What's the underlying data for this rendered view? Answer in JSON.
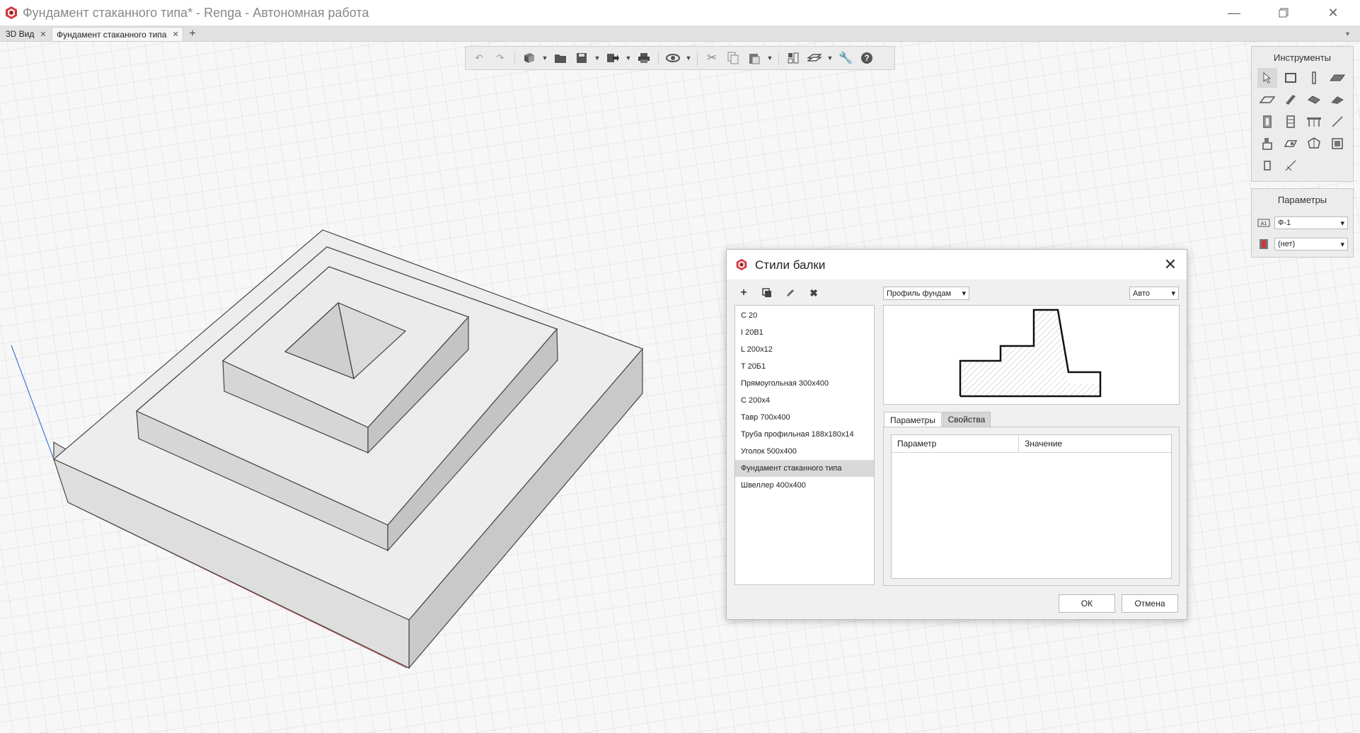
{
  "window": {
    "title": "Фундамент стаканного типа* - Renga - Автономная работа",
    "minimize_icon": "minimize-icon",
    "restore_icon": "restore-icon",
    "close_icon": "close-icon"
  },
  "tabs": [
    {
      "label": "3D Вид",
      "active": false
    },
    {
      "label": "Фундамент стаканного типа",
      "active": true
    }
  ],
  "tab_add_label": "+",
  "toolbar": {
    "buttons": [
      "undo-icon",
      "redo-icon",
      "3d-view-icon",
      "open-folder-icon",
      "save-icon",
      "export-icon",
      "print-icon",
      "orbit-icon",
      "cut-icon",
      "copy-icon",
      "paste-icon",
      "layers-icon",
      "visibility-icon",
      "settings-wrench-icon",
      "help-icon"
    ]
  },
  "tools_panel": {
    "title": "Инструменты",
    "tools": [
      "select-icon",
      "wall-icon",
      "column-icon",
      "slab-icon",
      "floor-icon",
      "beam-icon",
      "roof-icon",
      "ramp-icon",
      "door-icon",
      "window-icon",
      "stair-icon",
      "line-icon",
      "equipment-icon",
      "element-icon",
      "assembly-icon",
      "room-icon",
      "opening-icon",
      "dimension-icon"
    ]
  },
  "params_panel": {
    "title": "Параметры",
    "mark_value": "Ф-1",
    "material_value": "(нет)"
  },
  "dialog": {
    "title": "Стили балки",
    "close_label": "✕",
    "styles": [
      "С 20",
      "I 20B1",
      "L 200x12",
      "T 20Б1",
      "Прямоугольная 300x400",
      "С 200x4",
      "Тавр 700x400",
      "Труба профильная 188x180x14",
      "Уголок 500x400",
      "Фундамент стаканного типа",
      "Швеллер 400x400"
    ],
    "selected_index": 9,
    "profile_select": "Профиль фундам",
    "scale_select": "Авто",
    "tabs": [
      "Параметры",
      "Свойства"
    ],
    "table_headers": [
      "Параметр",
      "Значение"
    ],
    "ok_label": "ОК",
    "cancel_label": "Отмена"
  },
  "colors": {
    "accent_blue": "#3a7bd5",
    "selected_row": "#d9d9d9",
    "logo_red": "#d0343c"
  }
}
